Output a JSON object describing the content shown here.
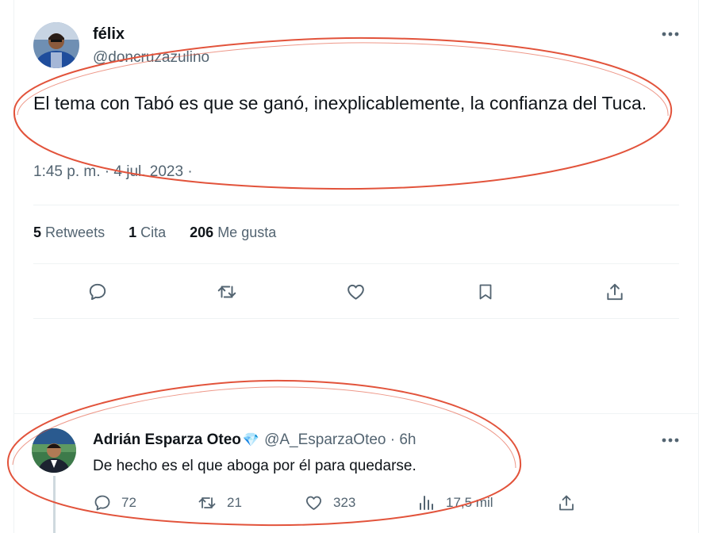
{
  "tweet": {
    "author_name": "félix",
    "author_handle": "@doncruzazulino",
    "text": "El tema con Tabó es que se ganó, inexplicablemente, la confianza del Tuca.",
    "timestamp": "1:45 p. m. · 4 jul. 2023 ·",
    "stats": {
      "retweets_count": "5",
      "retweets_label": "Retweets",
      "quotes_count": "1",
      "quotes_label": "Cita",
      "likes_count": "206",
      "likes_label": "Me gusta"
    },
    "actions": [
      "reply-icon",
      "retweet-icon",
      "like-icon",
      "bookmark-icon",
      "share-icon"
    ]
  },
  "reply": {
    "author_name": "Adrián Esparza Oteo",
    "badge": "💎",
    "author_handle": "@A_EsparzaOteo · 6h",
    "text": "De hecho es el que aboga por él para quedarse.",
    "replies": "72",
    "retweets": "21",
    "likes": "323",
    "views": "17,5 mil"
  },
  "colors": {
    "annotation": "#e2533b",
    "muted": "#536471",
    "text": "#0f1419",
    "border": "#eff3f4"
  }
}
